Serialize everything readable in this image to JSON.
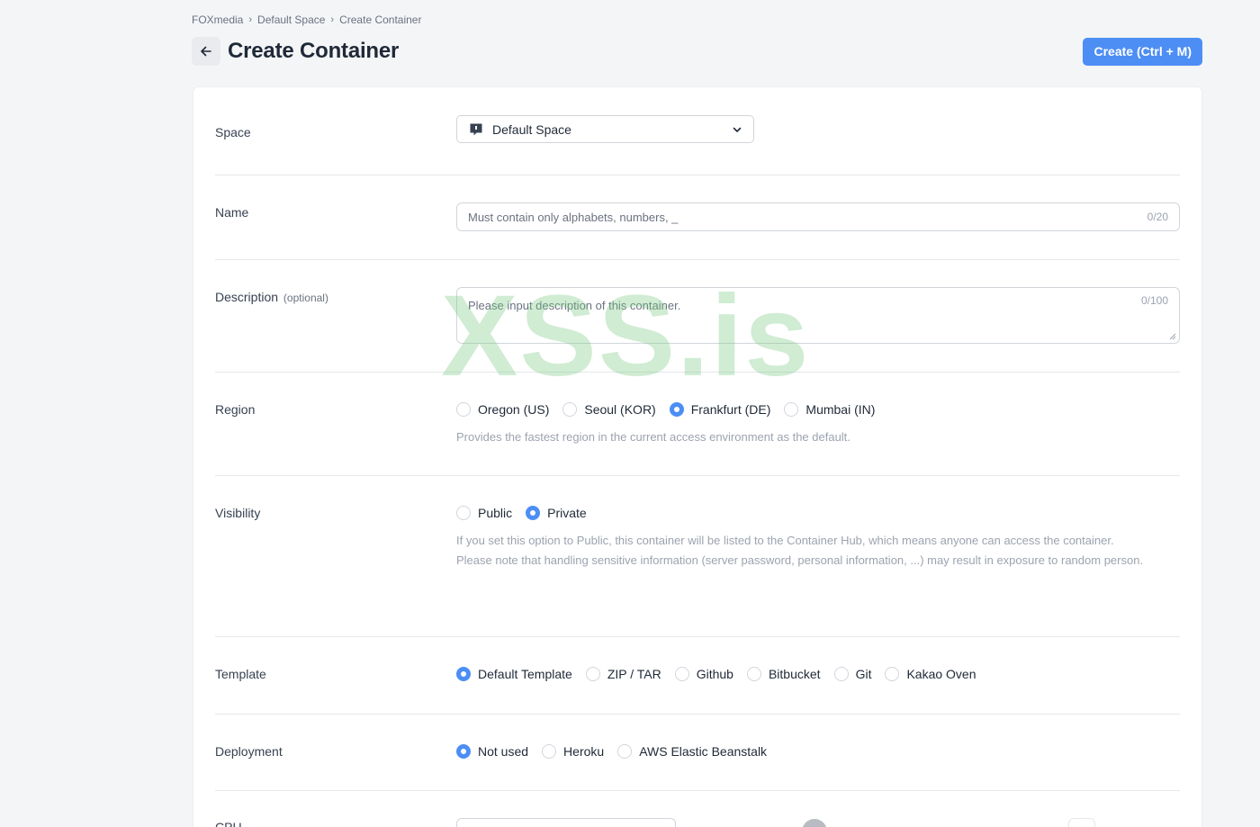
{
  "breadcrumb": [
    "FOXmedia",
    "Default Space",
    "Create Container"
  ],
  "page_title": "Create Container",
  "create_button": "Create (Ctrl + M)",
  "space": {
    "label": "Space",
    "selected": "Default Space"
  },
  "name": {
    "label": "Name",
    "placeholder": "Must contain only alphabets, numbers, _",
    "counter": "0/20"
  },
  "description": {
    "label": "Description",
    "optional": "(optional)",
    "placeholder": "Please input description of this container.",
    "counter": "0/100"
  },
  "region": {
    "label": "Region",
    "options": [
      "Oregon (US)",
      "Seoul (KOR)",
      "Frankfurt (DE)",
      "Mumbai (IN)"
    ],
    "selected": "Frankfurt (DE)",
    "hint": "Provides the fastest region in the current access environment as the default."
  },
  "visibility": {
    "label": "Visibility",
    "options": [
      "Public",
      "Private"
    ],
    "selected": "Private",
    "hint1": "If you set this option to Public, this container will be listed to the Container Hub, which means anyone can access the container.",
    "hint2": "Please note that handling sensitive information (server password, personal information, ...) may result in exposure to random person."
  },
  "template": {
    "label": "Template",
    "options": [
      "Default Template",
      "ZIP / TAR",
      "Github",
      "Bitbucket",
      "Git",
      "Kakao Oven"
    ],
    "selected": "Default Template"
  },
  "deployment": {
    "label": "Deployment",
    "options": [
      "Not used",
      "Heroku",
      "AWS Elastic Beanstalk"
    ],
    "selected": "Not used"
  },
  "cpu": {
    "label": "CPU"
  },
  "watermark": "XSS.is",
  "colors": {
    "accent": "#4d8ef5",
    "background": "#f4f5f7",
    "watermark": "#78c882"
  }
}
